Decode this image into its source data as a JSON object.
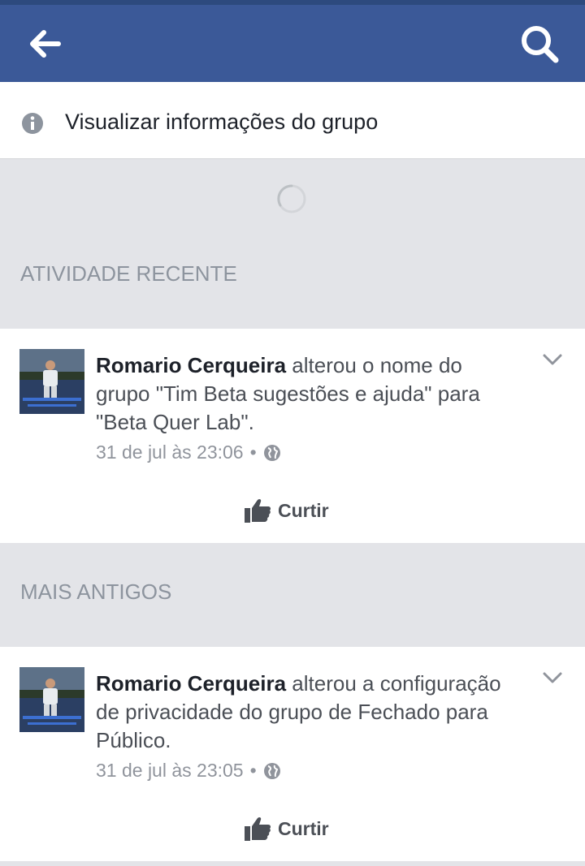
{
  "topbar": {
    "color": "#3b5998",
    "back_icon": "arrow-left-icon",
    "search_icon": "search-icon"
  },
  "info": {
    "icon": "info-icon",
    "label": "Visualizar informações do grupo"
  },
  "sections": {
    "recent": "ATIVIDADE RECENTE",
    "older": "MAIS ANTIGOS"
  },
  "posts": [
    {
      "author": "Romario Cerqueira",
      "text": " alterou o nome do grupo \"Tim Beta sugestões e ajuda\" para \"Beta Quer Lab\".",
      "time": "31 de jul às 23:06",
      "separator": "•",
      "privacy_icon": "globe-icon",
      "like_label": "Curtir"
    },
    {
      "author": "Romario Cerqueira",
      "text": " alterou a configuração de privacidade do grupo de Fechado para Público.",
      "time": "31 de jul às 23:05",
      "separator": "•",
      "privacy_icon": "globe-icon",
      "like_label": "Curtir"
    }
  ]
}
